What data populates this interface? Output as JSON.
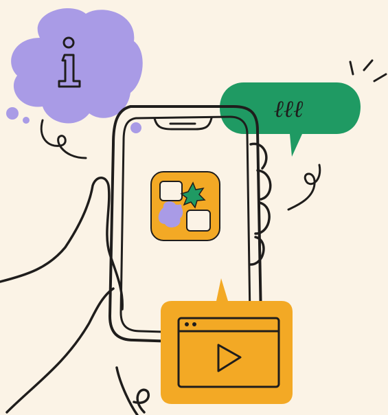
{
  "colors": {
    "background": "#fbf3e6",
    "ink": "#1f1d1c",
    "info_cloud": "#a99be6",
    "chat_bubble": "#1f9a63",
    "video_card": "#f3a925",
    "app_icon_bg": "#f3a925",
    "screen": "#ffffff"
  },
  "icons": {
    "info_cloud": "info-icon",
    "chat_bubble": "speech-bubble-icon",
    "video_card": "play-icon",
    "phone_app": "app-icon"
  },
  "info_cloud": {
    "glyph": "i"
  },
  "chat_bubble": {
    "text": "ℓℓℓ"
  }
}
